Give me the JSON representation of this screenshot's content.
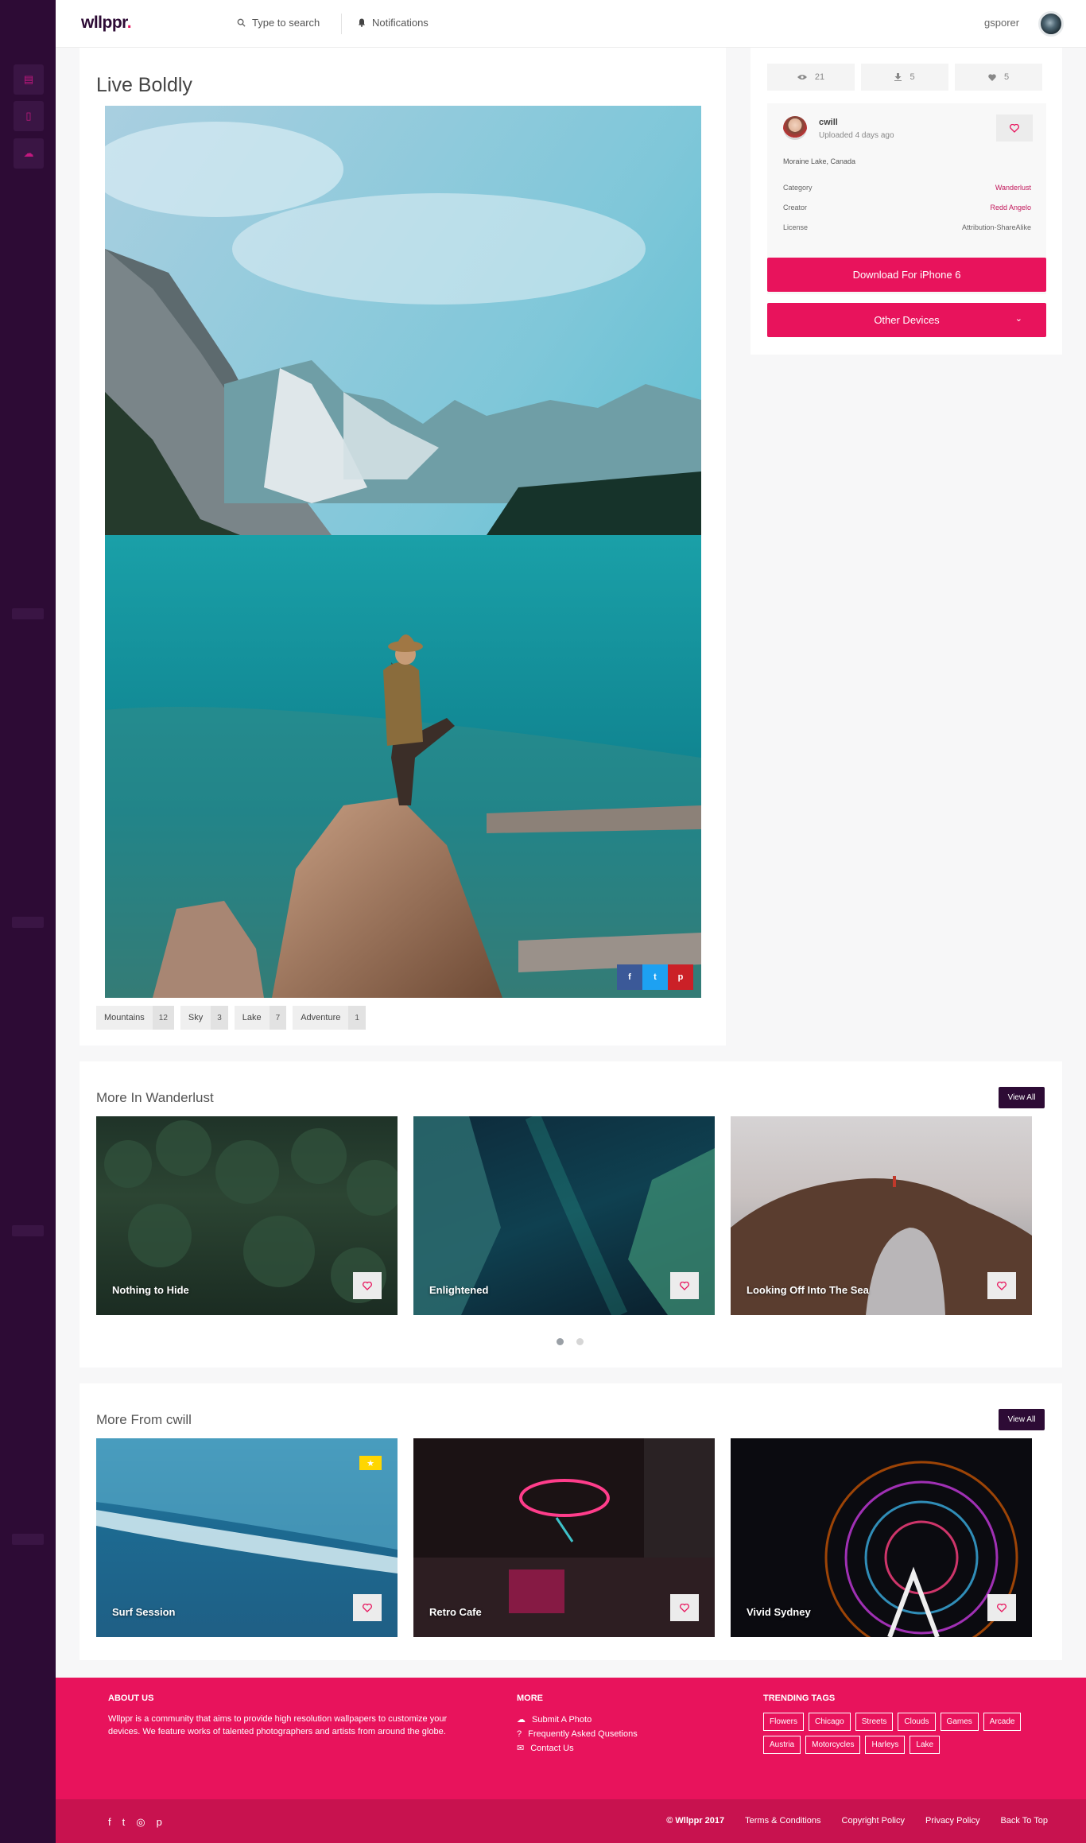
{
  "brand": {
    "logo": "wllppr",
    "logo_dot": "."
  },
  "topbar": {
    "search_placeholder": "Type to search",
    "notifications": "Notifications",
    "username": "gsporer"
  },
  "photo": {
    "title": "Live Boldly",
    "tags": [
      {
        "name": "Mountains",
        "count": "12"
      },
      {
        "name": "Sky",
        "count": "3"
      },
      {
        "name": "Lake",
        "count": "7"
      },
      {
        "name": "Adventure",
        "count": "1"
      }
    ],
    "share": {
      "facebook": "f",
      "twitter": "t",
      "pinterest": "p"
    }
  },
  "stats": {
    "views": "21",
    "downloads": "5",
    "likes": "5"
  },
  "uploader": {
    "name": "cwill",
    "uploaded": "Uploaded 4 days ago",
    "location": "Moraine Lake, Canada",
    "meta": [
      {
        "key": "Category",
        "value": "Wanderlust"
      },
      {
        "key": "Creator",
        "value": "Redd Angelo"
      },
      {
        "key": "License",
        "value": "Attribution-ShareAlike"
      }
    ]
  },
  "actions": {
    "download": "Download For iPhone 6",
    "other": "Other Devices"
  },
  "more_category": {
    "title": "More In Wanderlust",
    "view_all": "View All",
    "items": [
      {
        "label": "Nothing to Hide"
      },
      {
        "label": "Enlightened"
      },
      {
        "label": "Looking Off Into The Sea"
      }
    ]
  },
  "more_user": {
    "title": "More From cwill",
    "view_all": "View All",
    "items": [
      {
        "label": "Surf Session"
      },
      {
        "label": "Retro Cafe"
      },
      {
        "label": "Vivid Sydney"
      }
    ]
  },
  "footer": {
    "about_title": "ABOUT US",
    "about_text": "Wllppr is a community that aims to provide high resolution wallpapers to customize your devices. We feature works of talented photographers and artists from around the globe.",
    "more_title": "MORE",
    "more_links": [
      "Submit A Photo",
      "Frequently Asked Qusetions",
      "Contact Us"
    ],
    "tags_title": "TRENDING TAGS",
    "tags": [
      "Flowers",
      "Chicago",
      "Streets",
      "Clouds",
      "Games",
      "Arcade",
      "Austria",
      "Motorcycles",
      "Harleys",
      "Lake"
    ],
    "copyright": "© Wllppr 2017",
    "links": [
      "Terms & Conditions",
      "Copyright Policy",
      "Privacy Policy",
      "Back To Top"
    ]
  },
  "colors": {
    "accent": "#e8135c",
    "sidebar": "#2d0b35",
    "link": "#c2185b"
  }
}
